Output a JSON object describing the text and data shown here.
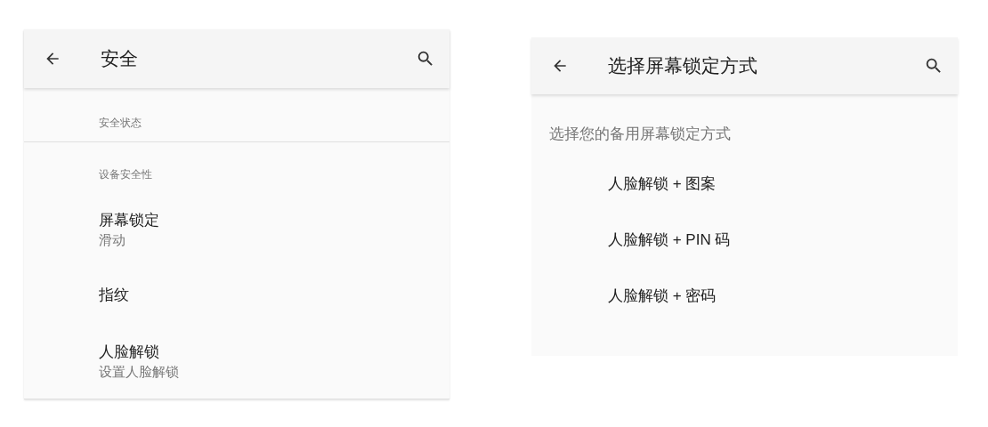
{
  "security_screen": {
    "title": "安全",
    "categories": [
      {
        "title": "安全状态"
      },
      {
        "title": "设备安全性",
        "items": [
          {
            "title": "屏幕锁定",
            "summary": "滑动"
          },
          {
            "title": "指纹"
          },
          {
            "title": "人脸解锁",
            "summary": "设置人脸解锁"
          }
        ]
      }
    ]
  },
  "lock_screen": {
    "title": "选择屏幕锁定方式",
    "prompt": "选择您的备用屏幕锁定方式",
    "options": [
      "人脸解锁 + 图案",
      "人脸解锁 + PIN 码",
      "人脸解锁 + 密码"
    ]
  }
}
